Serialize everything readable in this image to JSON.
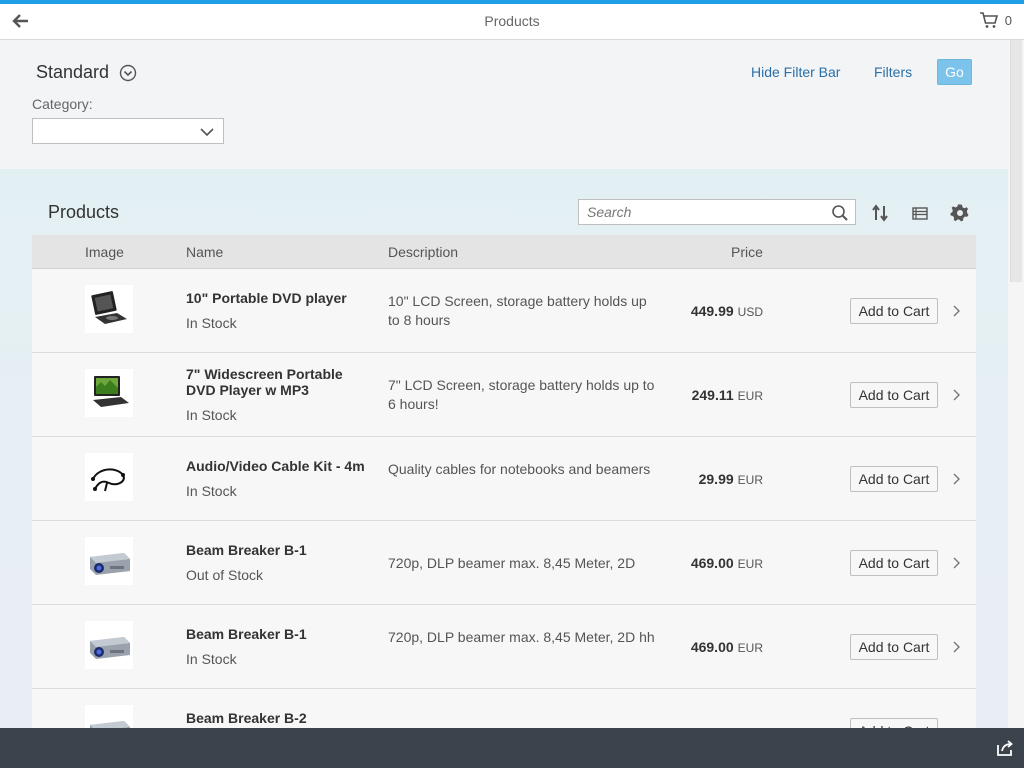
{
  "header": {
    "title": "Products",
    "cart_count": "0"
  },
  "filterbar": {
    "variant": "Standard",
    "hide_filter_bar": "Hide Filter Bar",
    "filters": "Filters",
    "go": "Go",
    "category_label": "Category:",
    "category_value": ""
  },
  "table": {
    "title": "Products",
    "search_placeholder": "Search",
    "columns": {
      "image": "Image",
      "name": "Name",
      "description": "Description",
      "price": "Price"
    },
    "add_to_cart": "Add to Cart",
    "rows": [
      {
        "name": "10\" Portable DVD player",
        "stock": "In Stock",
        "description": "10\" LCD Screen, storage battery holds up to 8 hours",
        "price": "449.99",
        "currency": "USD",
        "image": "dvd-player-icon"
      },
      {
        "name": "7\" Widescreen Portable DVD Player w MP3",
        "stock": "In Stock",
        "description": "7\" LCD Screen, storage battery holds up to 6 hours!",
        "price": "249.11",
        "currency": "EUR",
        "image": "dvd-player-widescreen-icon"
      },
      {
        "name": "Audio/Video Cable Kit - 4m",
        "stock": "In Stock",
        "description": "Quality cables for notebooks and beamers",
        "price": "29.99",
        "currency": "EUR",
        "image": "cable-kit-icon"
      },
      {
        "name": "Beam Breaker B-1",
        "stock": "Out of Stock",
        "description": "720p, DLP beamer max. 8,45 Meter, 2D",
        "price": "469.00",
        "currency": "EUR",
        "image": "projector-icon"
      },
      {
        "name": "Beam Breaker B-1",
        "stock": "In Stock",
        "description": "720p, DLP beamer max. 8,45 Meter, 2D hh",
        "price": "469.00",
        "currency": "EUR",
        "image": "projector-icon"
      },
      {
        "name": "Beam Breaker B-2",
        "stock": "",
        "description": "",
        "price": "",
        "currency": "",
        "image": "projector-icon"
      }
    ]
  }
}
